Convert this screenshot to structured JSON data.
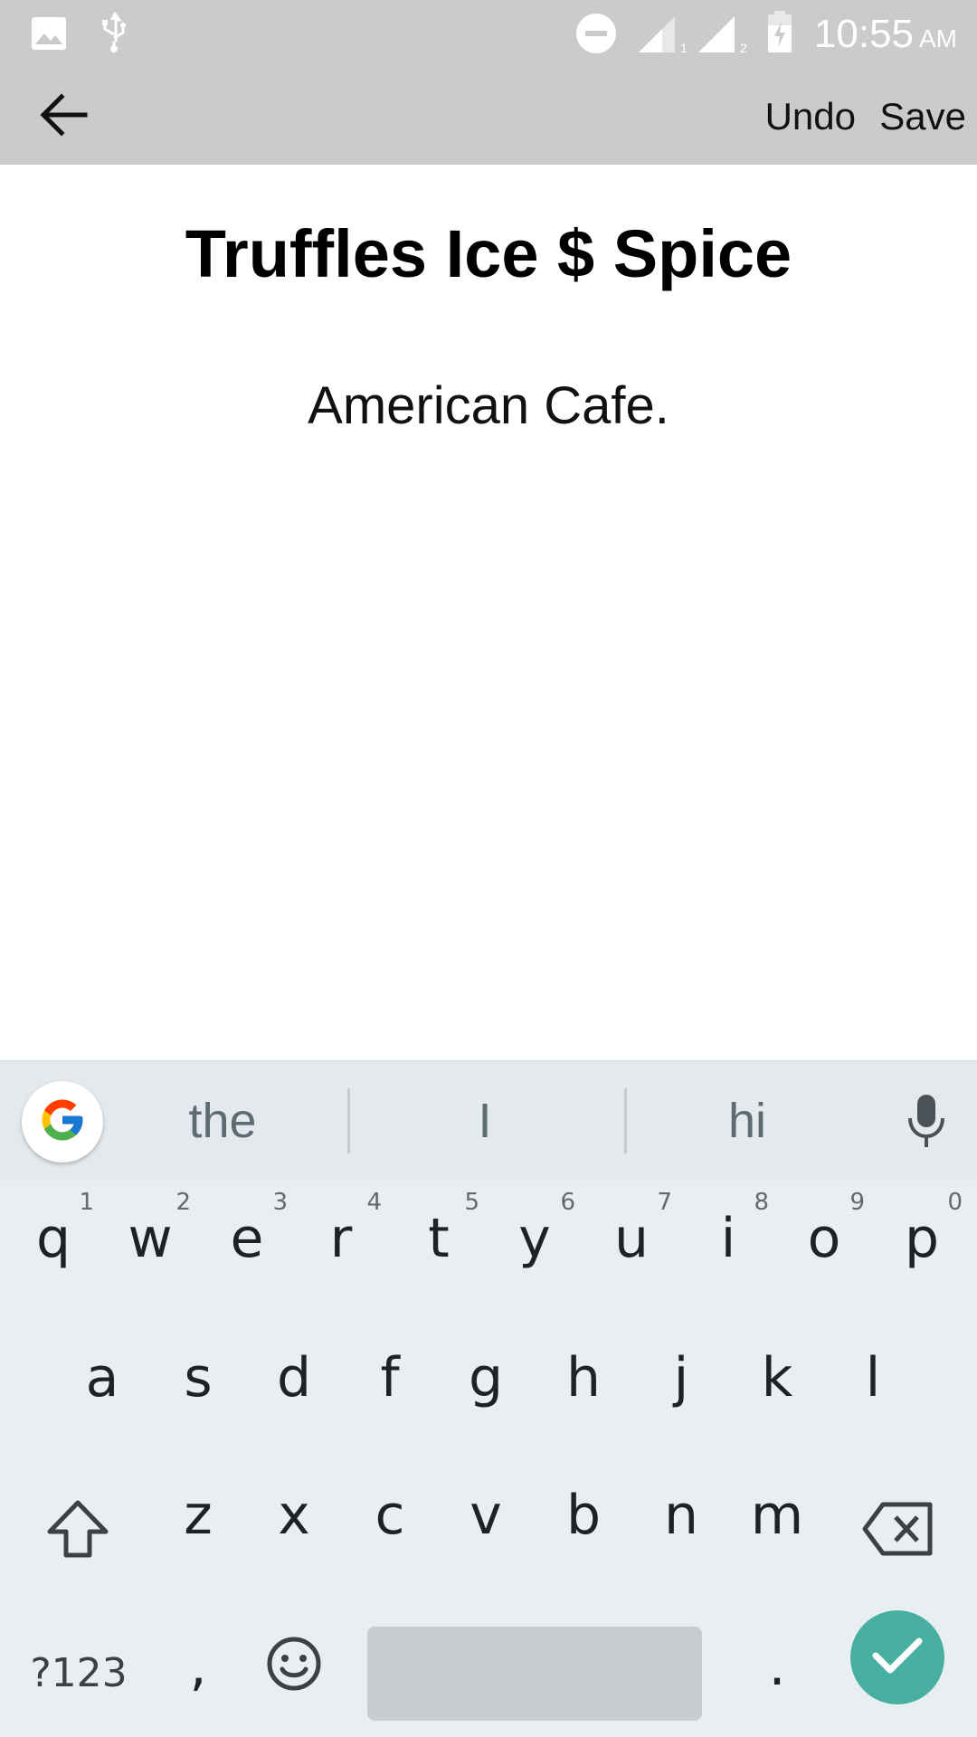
{
  "status_bar": {
    "time": "10:55",
    "ampm": "AM",
    "icons": [
      "image-icon",
      "usb-icon",
      "do-not-disturb-icon",
      "signal-sim1-icon",
      "signal-sim2-icon",
      "battery-charging-icon"
    ],
    "sim1_label": "1",
    "sim2_label": "2"
  },
  "app_bar": {
    "back_icon": "arrow-left-icon",
    "undo_label": "Undo",
    "save_label": "Save"
  },
  "content": {
    "title": "Truffles Ice $ Spice",
    "subtitle": "American Cafe."
  },
  "keyboard": {
    "suggestions": [
      "the",
      "I",
      "hi"
    ],
    "row1": [
      {
        "key": "q",
        "hint": "1"
      },
      {
        "key": "w",
        "hint": "2"
      },
      {
        "key": "e",
        "hint": "3"
      },
      {
        "key": "r",
        "hint": "4"
      },
      {
        "key": "t",
        "hint": "5"
      },
      {
        "key": "y",
        "hint": "6"
      },
      {
        "key": "u",
        "hint": "7"
      },
      {
        "key": "i",
        "hint": "8"
      },
      {
        "key": "o",
        "hint": "9"
      },
      {
        "key": "p",
        "hint": "0"
      }
    ],
    "row2": [
      "a",
      "s",
      "d",
      "f",
      "g",
      "h",
      "j",
      "k",
      "l"
    ],
    "row3": [
      "z",
      "x",
      "c",
      "v",
      "b",
      "n",
      "m"
    ],
    "symbols_label": "?123",
    "comma": ",",
    "period": ".",
    "accent_color": "#47b0a0"
  }
}
